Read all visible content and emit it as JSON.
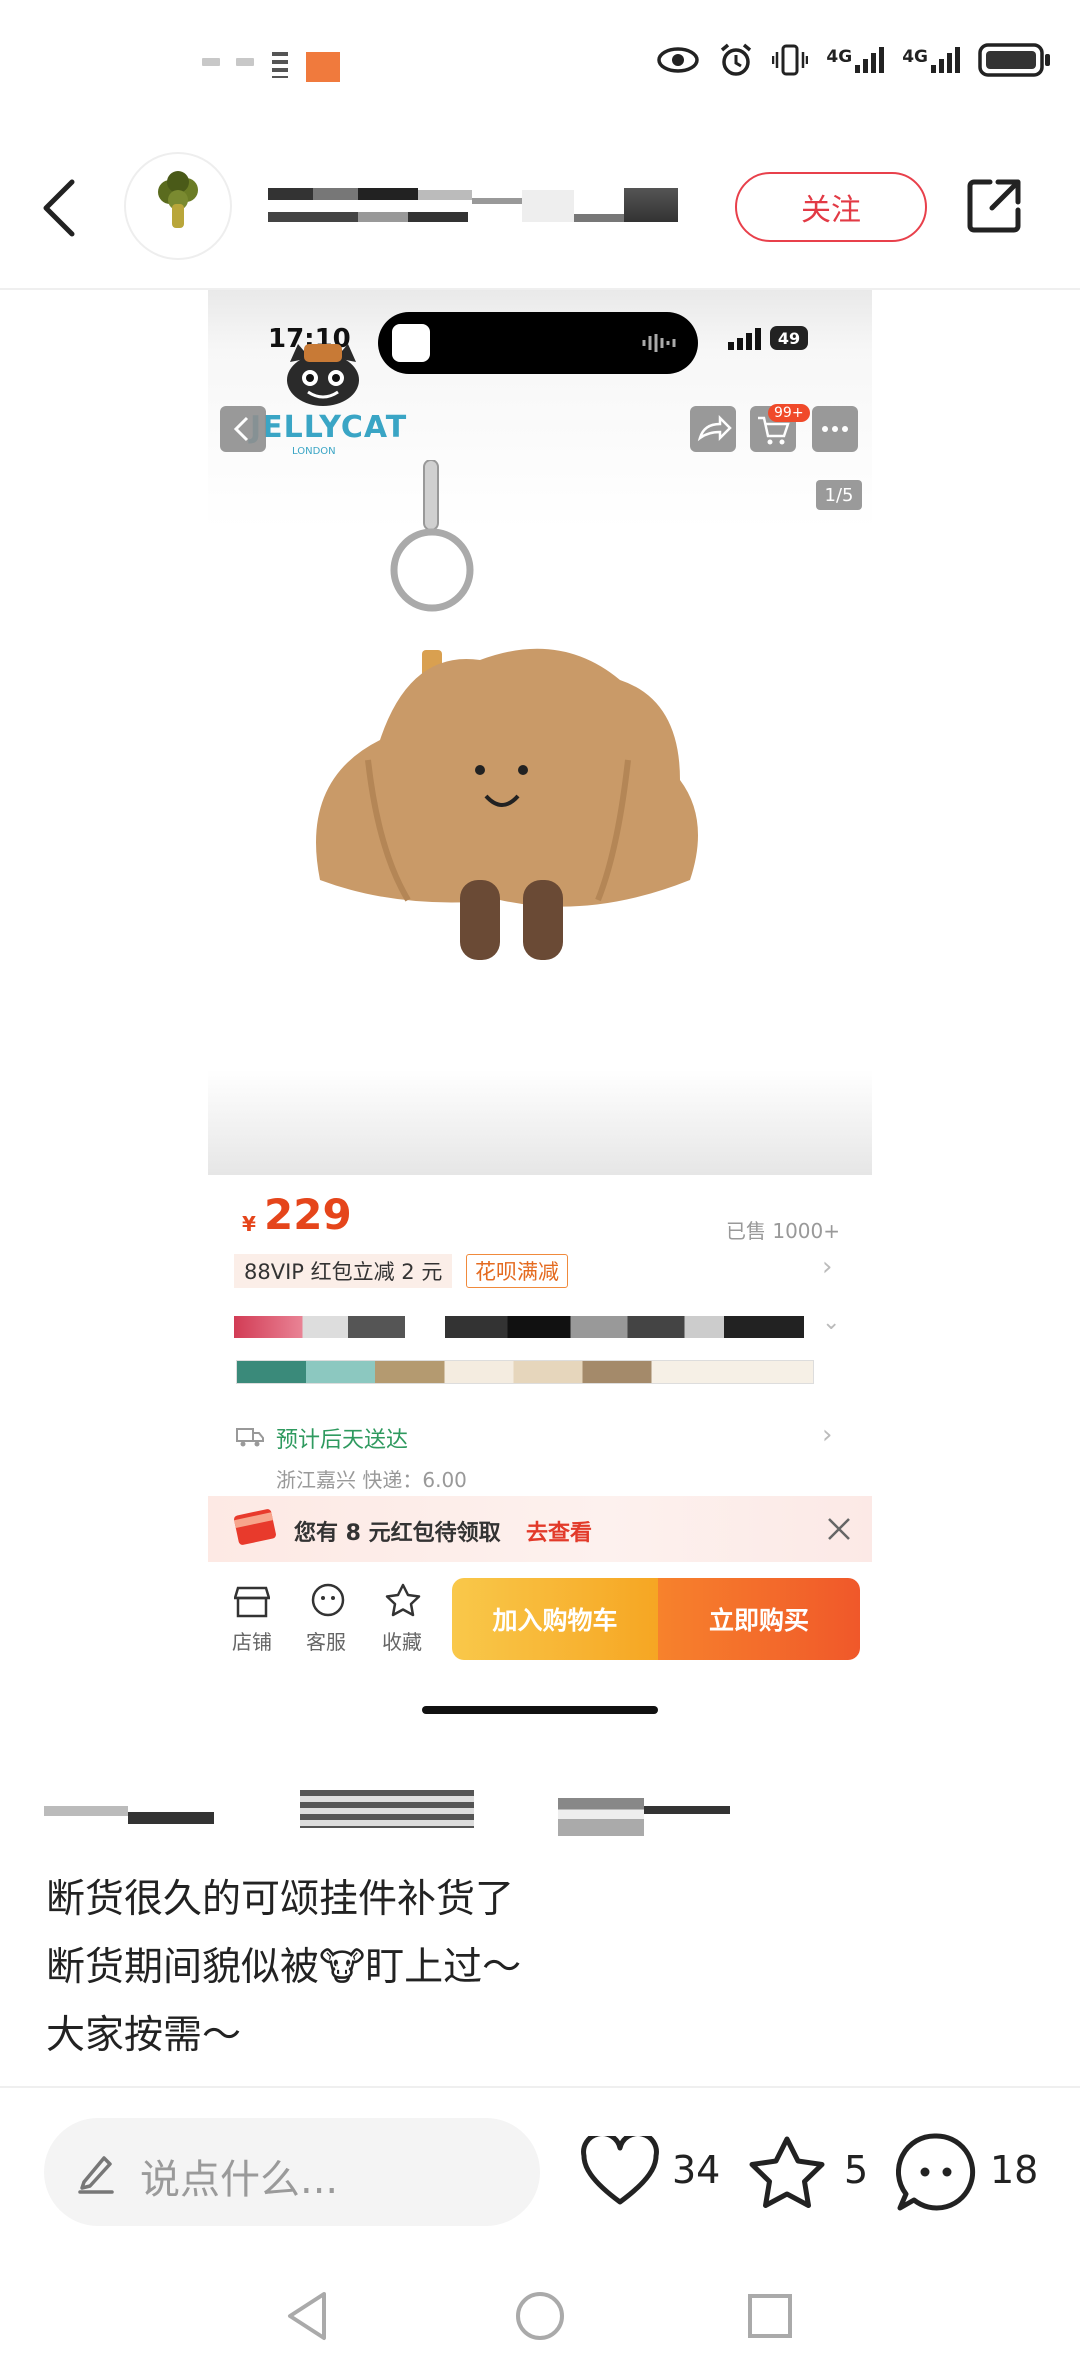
{
  "status_bar": {
    "network_1": "4G",
    "network_2": "4G"
  },
  "header": {
    "follow_label": "关注"
  },
  "screenshot": {
    "time": "17:10",
    "battery": "49",
    "brand": "JELLYCAT",
    "brand_sub": "LONDON",
    "cart_badge": "99+",
    "pager": "1/5",
    "price_symbol": "¥",
    "price": "229",
    "sold": "已售 1000+",
    "vip_promo": "88VIP 红包立减 2 元",
    "huabei": "花呗满减",
    "shipping": "预计后天送达",
    "origin": "浙江嘉兴  快递：6.00",
    "redpack_text": "您有 8 元红包待领取",
    "redpack_link": "去查看",
    "bottom_icons": [
      "店铺",
      "客服",
      "收藏"
    ],
    "add_to_cart": "加入购物车",
    "buy_now": "立即购买"
  },
  "post": {
    "lines": [
      "断货很久的可颂挂件补货了",
      "断货期间貌似被🐮盯上过～",
      "大家按需～"
    ]
  },
  "bottom_bar": {
    "comment_placeholder": "说点什么...",
    "likes": "34",
    "stars": "5",
    "comments": "18"
  },
  "colors": {
    "accent_red": "#e23a45",
    "price_orange": "#e5451b",
    "cart_yellow": "#f6a623",
    "buy_orange": "#f0582a"
  }
}
